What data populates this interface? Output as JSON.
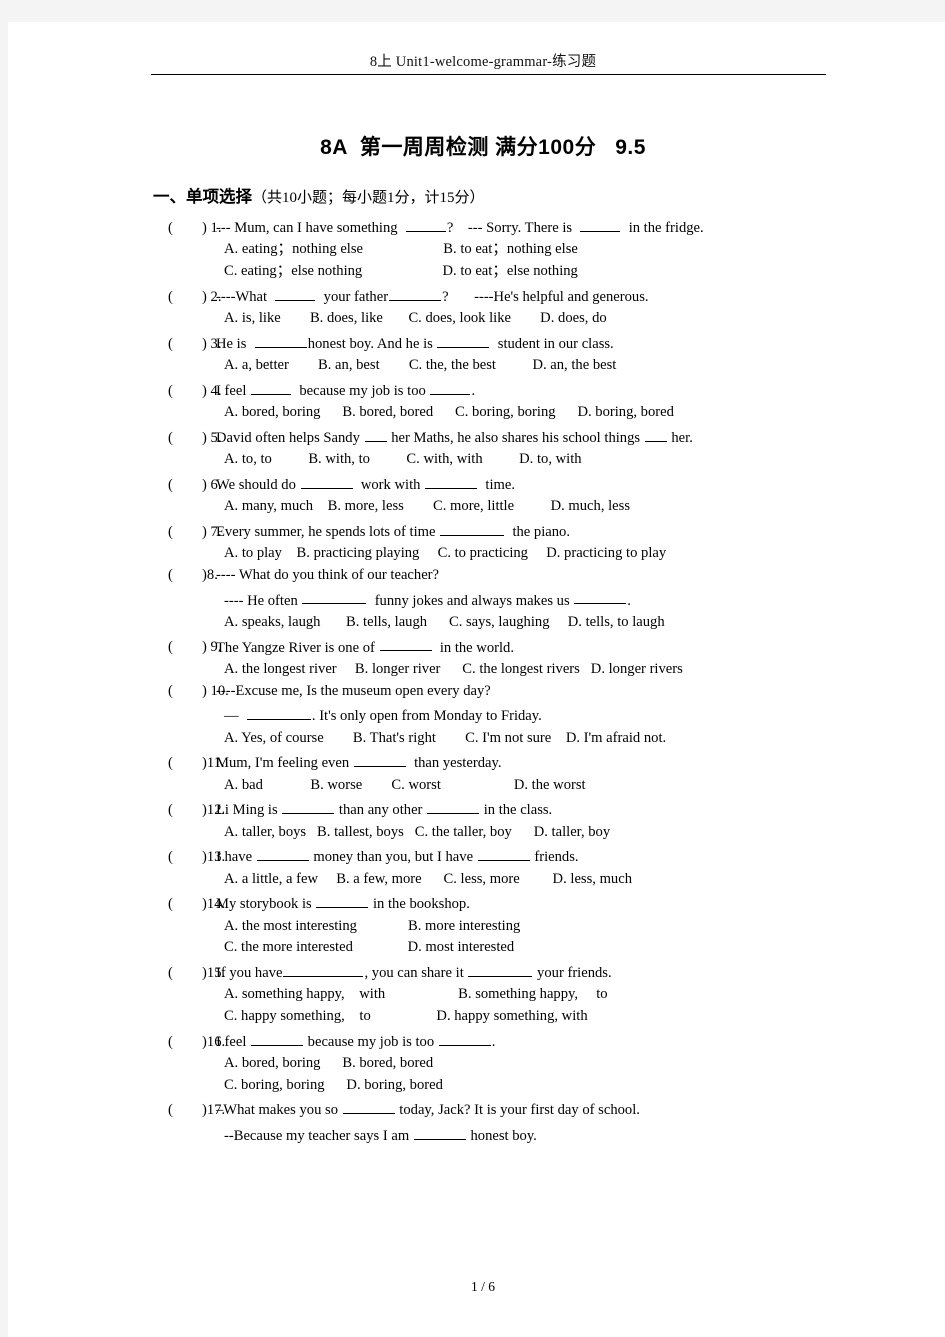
{
  "header": {
    "running_head": "8上 Unit1-welcome-grammar-练习题"
  },
  "title": "8A  第一周周检测 满分100分   9.5",
  "section": {
    "label": "一、单项选择",
    "note": "（共10小题；每小题1分，计15分）"
  },
  "questions": [
    {
      "mark": "(        ) 1.",
      "lines": [
        "--- Mum, can I have something  ____?    --- Sorry. There is  ____  in the fridge.",
        "A. eating；nothing else                      B. to eat；nothing else",
        "C. eating；else nothing                      D. to eat；else nothing"
      ]
    },
    {
      "mark": "(        ) 2.",
      "lines": [
        "----What  ____  your father______?       ----He's helpful and generous.",
        "A. is, like        B. does, like       C. does, look like        D. does, do"
      ]
    },
    {
      "mark": "(        ) 3.",
      "lines": [
        "He is  ______honest boy. And he is ______  student in our class.",
        "A. a, better        B. an, best        C. the, the best          D. an, the best"
      ]
    },
    {
      "mark": "(        ) 4.",
      "lines": [
        "I feel _____  because my job is too _____.",
        "A. bored, boring      B. bored, bored      C. boring, boring      D. boring, bored"
      ]
    },
    {
      "mark": "(        ) 5.",
      "lines": [
        "David often helps Sandy ___ her Maths, he also shares his school things ___ her.",
        "A. to, to          B. with, to          C. with, with          D. to, with"
      ]
    },
    {
      "mark": "(        ) 6.",
      "lines": [
        "We should do ______  work with _______  time.",
        "A. many, much    B. more, less        C. more, little          D. much, less"
      ]
    },
    {
      "mark": "(        ) 7.",
      "lines": [
        "Every summer, he spends lots of time ________  the piano.",
        "A. to play    B. practicing playing     C. to practicing     D. practicing to play"
      ]
    },
    {
      "mark": "(        )8.",
      "lines": [
        "---- What do you think of our teacher?",
        "---- He often ________  funny jokes and always makes us _______.",
        "A. speaks, laugh       B. tells, laugh      C. says, laughing     D. tells, to laugh"
      ]
    },
    {
      "mark": "(        ) 9.",
      "lines": [
        "The Yangze River is one of ______  in the world.",
        "A. the longest river     B. longer river      C. the longest rivers   D. longer rivers"
      ]
    },
    {
      "mark": "(        ) 10.",
      "lines": [
        "----Excuse me, Is the museum open every day?",
        "—  ________. It's only open from Monday to Friday.",
        "A. Yes, of course        B. That's right        C. I'm not sure    D. I'm afraid not."
      ]
    },
    {
      "mark": "(        )11.",
      "lines": [
        "Mum, I'm feeling even ______  than yesterday.",
        "A. bad             B. worse        C. worst                    D. the worst"
      ]
    },
    {
      "mark": "(        )12.",
      "lines": [
        "Li Ming is ______ than any other ______ in the class.",
        "A. taller, boys   B. tallest, boys   C. the taller, boy      D. taller, boy"
      ]
    },
    {
      "mark": "(        )13.",
      "lines": [
        "I have ______ money than you, but I have ______ friends.",
        "A. a little, a few     B. a few, more      C. less, more         D. less, much"
      ]
    },
    {
      "mark": "(        )14.",
      "lines": [
        "My storybook is ______ in the bookshop.",
        "A. the most interesting              B. more interesting",
        "C. the more interested               D. most interested"
      ]
    },
    {
      "mark": "(        )15.",
      "lines": [
        "If you have___________, you can share it ________ your friends.",
        "A. something happy,    with                    B. something happy,     to",
        "C. happy something,    to                  D. happy something, with"
      ]
    },
    {
      "mark": "(        )16.",
      "lines": [
        "I feel ______ because my job is too ______.",
        "A. bored, boring      B. bored, bored",
        "C. boring, boring      D. boring, bored"
      ]
    },
    {
      "mark": "(        )17.",
      "lines": [
        "–What makes you so _______ today, Jack? It is your first day of school.",
        "--Because my teacher says I am _______ honest boy."
      ]
    }
  ],
  "footer": "1 / 6"
}
